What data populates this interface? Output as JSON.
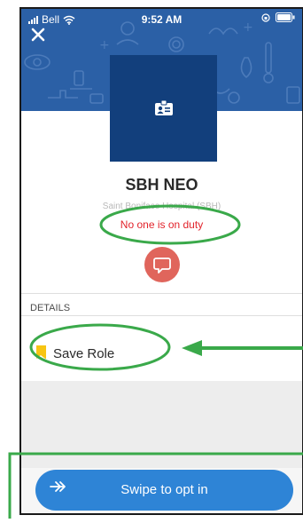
{
  "status_bar": {
    "carrier": "Bell",
    "time": "9:52 AM"
  },
  "header": {
    "close_icon": "close-icon",
    "background_color": "#2b60a6"
  },
  "profile": {
    "title": "SBH NEO",
    "subtitle": "Saint Boniface Hospital (SBH)",
    "duty_status": "No one is on duty",
    "badge_icon": "id-badge-icon",
    "message_icon": "chat-bubble-icon"
  },
  "details": {
    "section_label": "DETAILS",
    "role_label": "Save Role"
  },
  "footer": {
    "swipe_icon": "double-arrow-right-icon",
    "swipe_label": "Swipe to opt in"
  },
  "colors": {
    "accent_blue": "#2e84d6",
    "avatar_bg": "#123f7c",
    "alert_red": "#e2232b",
    "message_button": "#e0655c",
    "bookmark_yellow": "#f7c513",
    "annotation_green": "#3aa94a"
  }
}
